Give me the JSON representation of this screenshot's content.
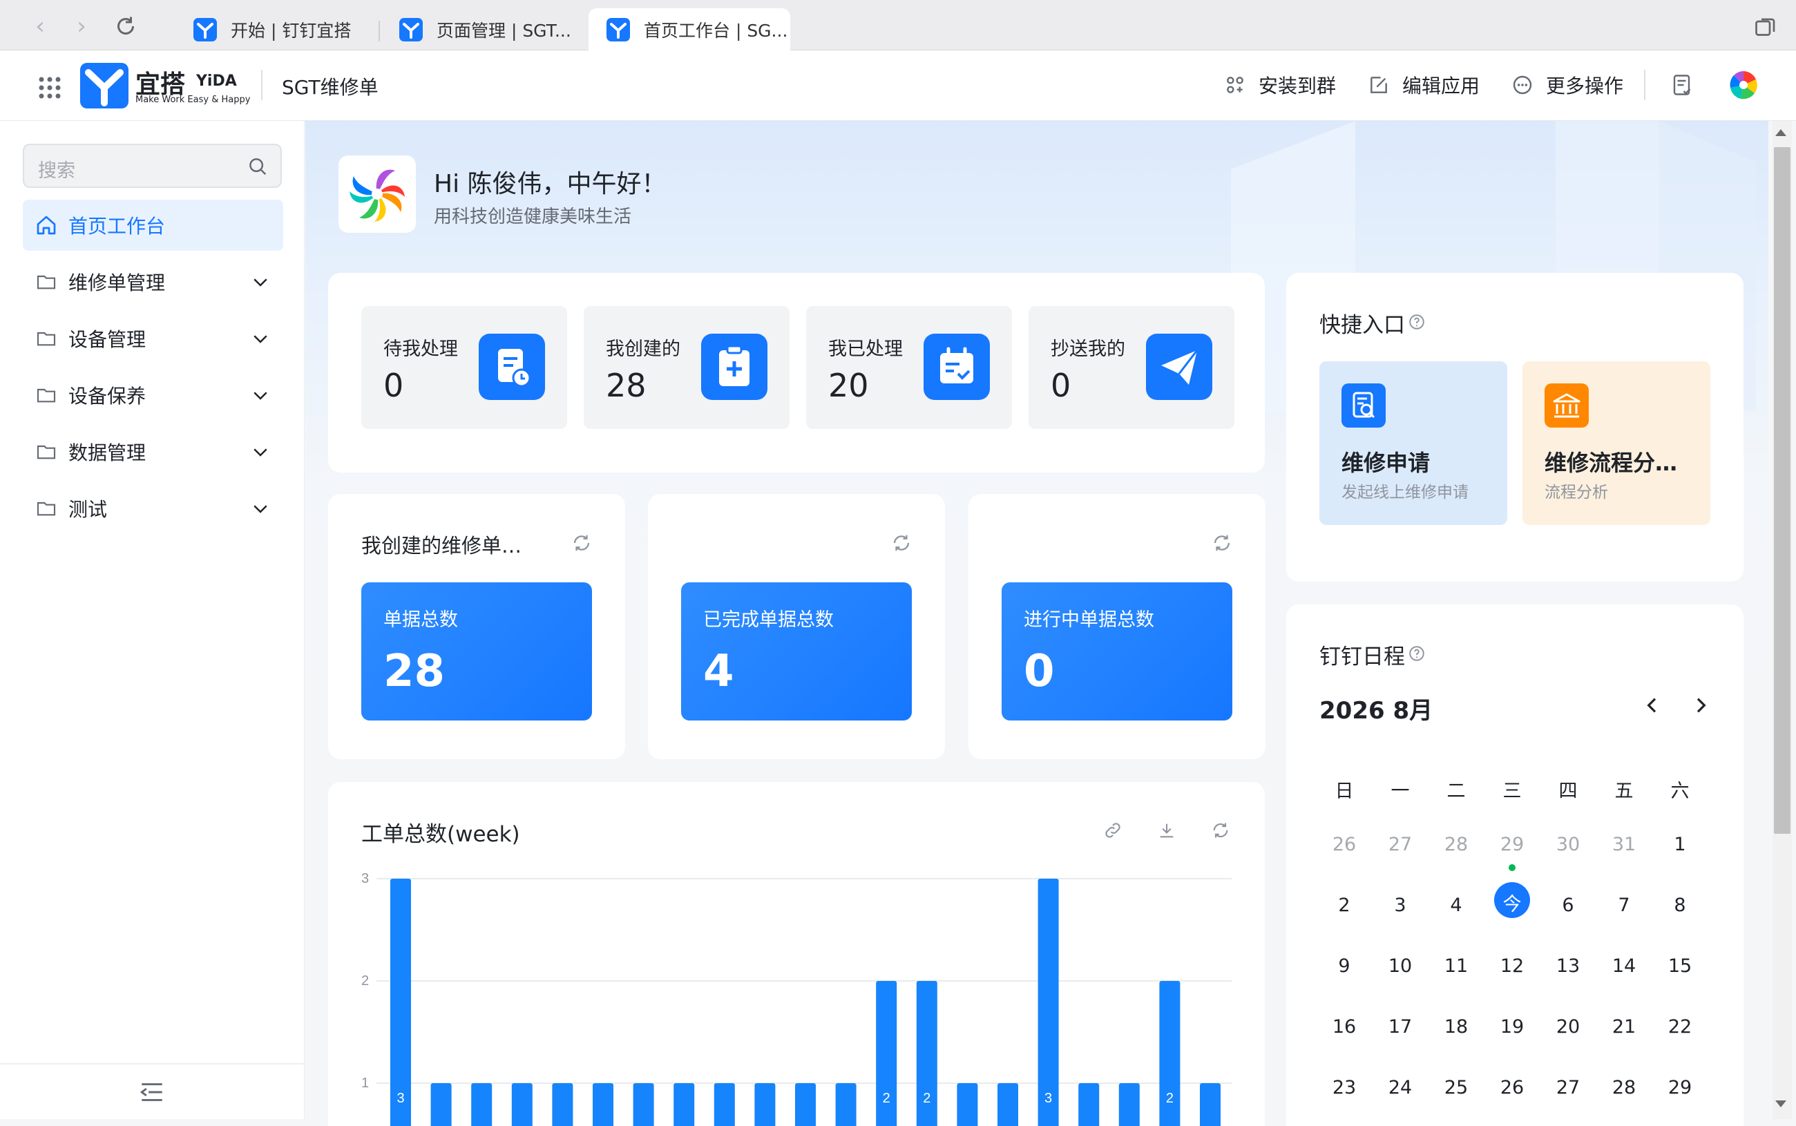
{
  "browser": {
    "tabs": [
      {
        "label": "开始 | 钉钉宜搭"
      },
      {
        "label": "页面管理 | SGT..."
      },
      {
        "label": "首页工作台 | SG..."
      }
    ]
  },
  "header": {
    "brand": "宜搭",
    "brand_en": "YiDA",
    "tagline": "Make Work Easy & Happy",
    "app_name": "SGT维修单",
    "actions": {
      "install": "安装到群",
      "edit": "编辑应用",
      "more": "更多操作"
    }
  },
  "sidebar": {
    "search_placeholder": "搜索",
    "items": [
      {
        "label": "首页工作台"
      },
      {
        "label": "维修单管理"
      },
      {
        "label": "设备管理"
      },
      {
        "label": "设备保养"
      },
      {
        "label": "数据管理"
      },
      {
        "label": "测试"
      }
    ]
  },
  "greeting": {
    "title": "Hi 陈俊伟，中午好！",
    "subtitle": "用科技创造健康美味生活"
  },
  "stats": [
    {
      "label": "待我处理",
      "value": "0"
    },
    {
      "label": "我创建的",
      "value": "28"
    },
    {
      "label": "我已处理",
      "value": "20"
    },
    {
      "label": "抄送我的",
      "value": "0"
    }
  ],
  "metrics": {
    "card1_title": "我创建的维修单…",
    "items": [
      {
        "label": "单据总数",
        "value": "28"
      },
      {
        "label": "已完成单据总数",
        "value": "4"
      },
      {
        "label": "进行中单据总数",
        "value": "0"
      }
    ]
  },
  "quick": {
    "title": "快捷入口",
    "items": [
      {
        "title": "维修申请",
        "sub": "发起线上维修申请"
      },
      {
        "title": "维修流程分…",
        "sub": "流程分析"
      }
    ]
  },
  "calendar": {
    "title": "钉钉日程",
    "month": "2026 8月",
    "weekdays": [
      "日",
      "一",
      "二",
      "三",
      "四",
      "五",
      "六"
    ],
    "rows": [
      [
        "26",
        "27",
        "28",
        "29",
        "30",
        "31",
        "1"
      ],
      [
        "2",
        "3",
        "4",
        "今",
        "6",
        "7",
        "8"
      ],
      [
        "9",
        "10",
        "11",
        "12",
        "13",
        "14",
        "15"
      ],
      [
        "16",
        "17",
        "18",
        "19",
        "20",
        "21",
        "22"
      ],
      [
        "23",
        "24",
        "25",
        "26",
        "27",
        "28",
        "29"
      ]
    ]
  },
  "chart_data": {
    "type": "bar",
    "title": "工单总数(week)",
    "ylim": [
      0,
      3
    ],
    "yticks": [
      "1",
      "2",
      "3"
    ],
    "values": [
      3,
      1,
      1,
      1,
      1,
      1,
      1,
      1,
      1,
      1,
      1,
      1,
      2,
      2,
      1,
      1,
      3,
      1,
      1,
      2,
      1
    ],
    "data_labels": [
      "3",
      "",
      "",
      "",
      "",
      "",
      "",
      "",
      "",
      "",
      "",
      "",
      "2",
      "2",
      "",
      "",
      "3",
      "",
      "",
      "2",
      ""
    ],
    "color": "#1684fc"
  },
  "colors": {
    "accent": "#1677ff",
    "quick_blue_bg": "#dbeafb",
    "quick_orange_bg": "#fdf0de",
    "quick_orange_icon": "#ff8800",
    "today_dot": "#00b853"
  }
}
